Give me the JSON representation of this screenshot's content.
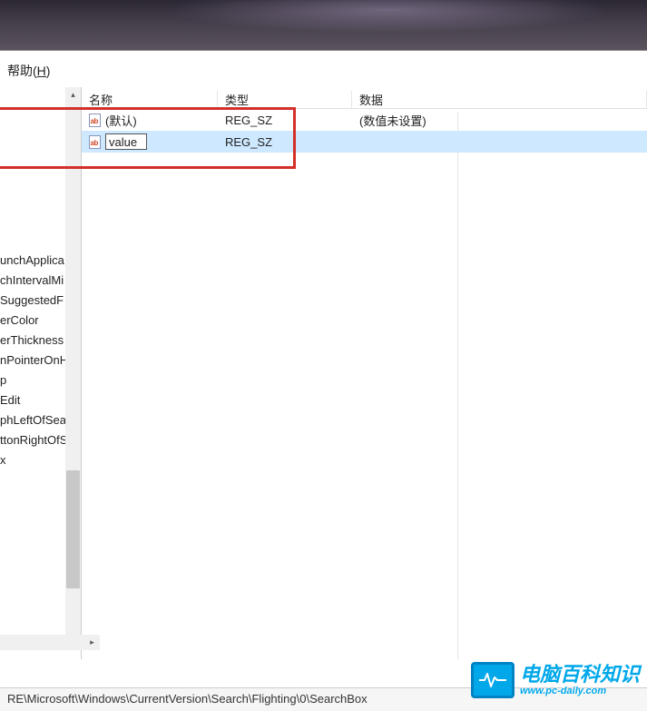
{
  "header": {},
  "menu": {
    "help_label": "帮助",
    "help_key": "H"
  },
  "columns": {
    "name": "名称",
    "type": "类型",
    "data": "数据"
  },
  "rows": [
    {
      "icon": "reg-sz-icon",
      "name": "(默认)",
      "type": "REG_SZ",
      "data": "(数值未设置)",
      "editing": false,
      "selected": false
    },
    {
      "icon": "reg-sz-icon",
      "name": "value",
      "type": "REG_SZ",
      "data": "",
      "editing": true,
      "selected": true
    }
  ],
  "tree": {
    "items": [
      "unchApplica",
      "",
      "chIntervalMi",
      "SuggestedF",
      "erColor",
      "erThickness",
      "nPointerOnH",
      "p",
      "Edit",
      "phLeftOfSea",
      "ttonRightOfS",
      "x"
    ]
  },
  "statusbar": {
    "path": "RE\\Microsoft\\Windows\\CurrentVersion\\Search\\Flighting\\0\\SearchBox"
  },
  "watermark": {
    "title": "电脑百科知识",
    "url": "www.pc-daily.com"
  }
}
